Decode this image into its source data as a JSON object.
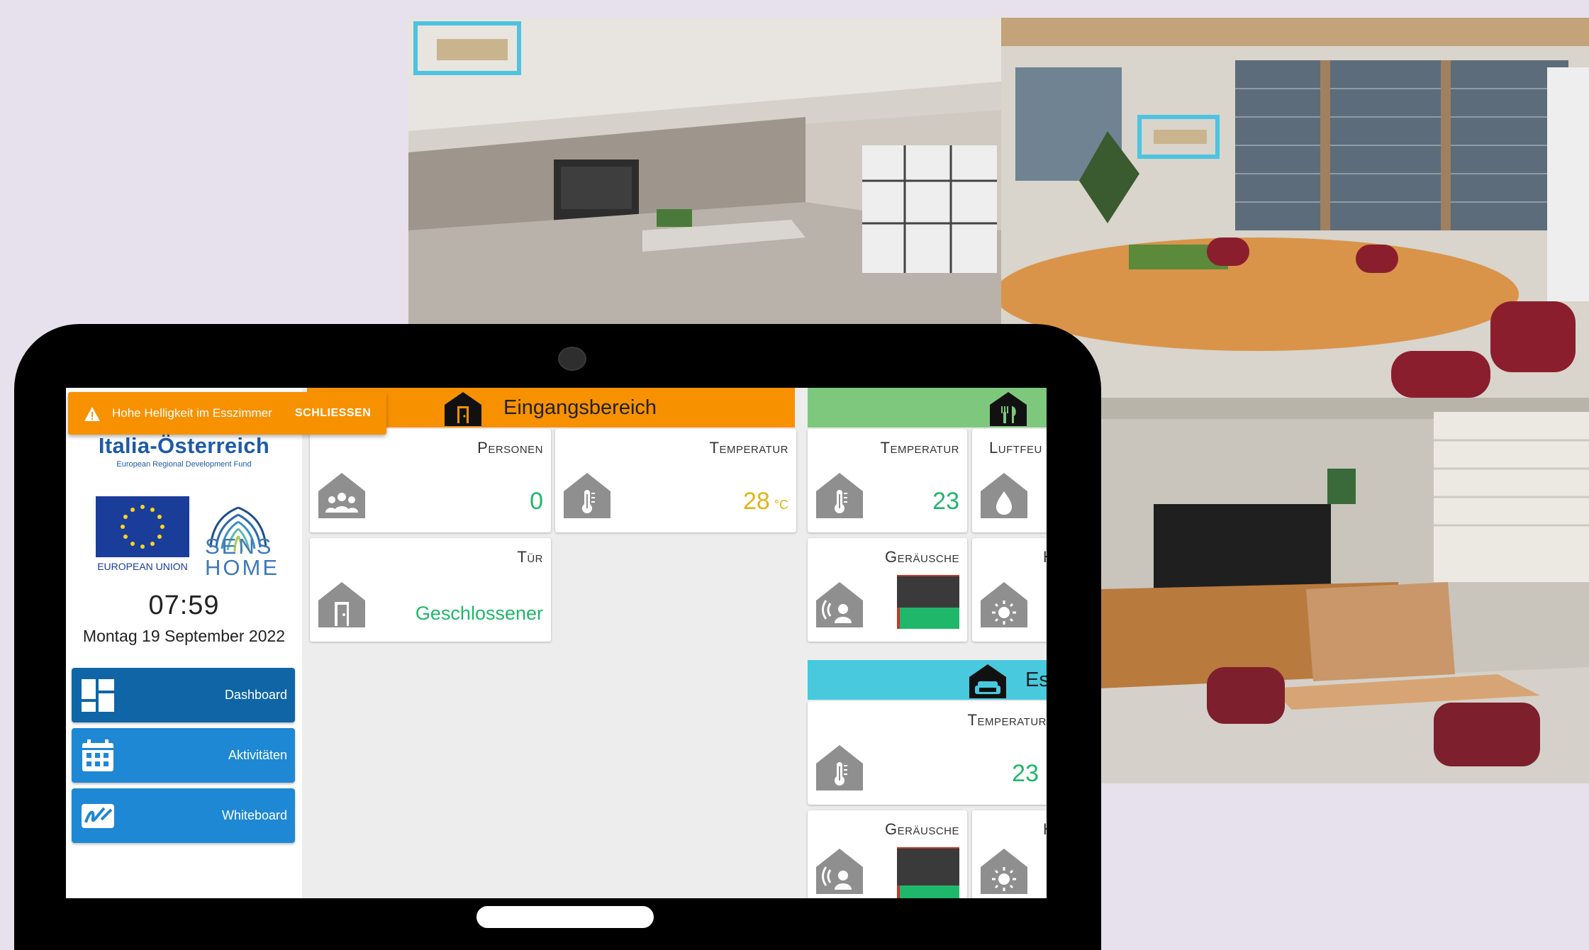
{
  "toast": {
    "message": "Hohe Helligkeit im Esszimmer",
    "close_label": "SCHLIESSEN",
    "color": "#f79100"
  },
  "sidebar": {
    "brand": "Italia-Österreich",
    "brand_subtitle": "European Regional Development Fund",
    "eu_label": "EUROPEAN UNION",
    "logo_line1": "SENS",
    "logo_line2": "HOME",
    "time": "07:59",
    "date": "Montag  19 September 2022",
    "nav": [
      {
        "label": "Dashboard",
        "icon": "dashboard-icon",
        "active": true
      },
      {
        "label": "Aktivitäten",
        "icon": "calendar-icon",
        "active": false
      },
      {
        "label": "Whiteboard",
        "icon": "whiteboard-icon",
        "active": false
      }
    ]
  },
  "rooms": {
    "entrance": {
      "title": "Eingangsbereich",
      "color": "#f79100",
      "icon": "house-door-icon",
      "cards": {
        "persons": {
          "title": "Personen",
          "value": "0",
          "icon": "people-icon"
        },
        "temperature": {
          "title": "Temperatur",
          "value": "28",
          "unit": "°C",
          "icon": "thermometer-icon"
        },
        "door": {
          "title": "Tür",
          "value": "Geschlossener",
          "icon": "door-icon"
        }
      }
    },
    "kitchen": {
      "title": "",
      "color": "#7ec87e",
      "icon": "cutlery-icon",
      "cards": {
        "temperature": {
          "title": "Temperatur",
          "value": "23",
          "icon": "thermometer-icon"
        },
        "humidity": {
          "title": "Luftfeu",
          "icon": "droplet-icon"
        },
        "noise": {
          "title": "Geräusche",
          "level": 0.4,
          "icon": "noise-icon"
        },
        "brightness": {
          "title": "H",
          "icon": "sun-icon"
        }
      }
    },
    "living": {
      "title": "Es",
      "color": "#48c9de",
      "icon": "sofa-icon",
      "cards": {
        "temperature": {
          "title": "Temperatur",
          "value": "23",
          "icon": "thermometer-icon"
        },
        "noise": {
          "title": "Geräusche",
          "level": 0.3,
          "icon": "noise-icon"
        },
        "brightness": {
          "title": "H",
          "icon": "sun-icon"
        }
      }
    }
  }
}
